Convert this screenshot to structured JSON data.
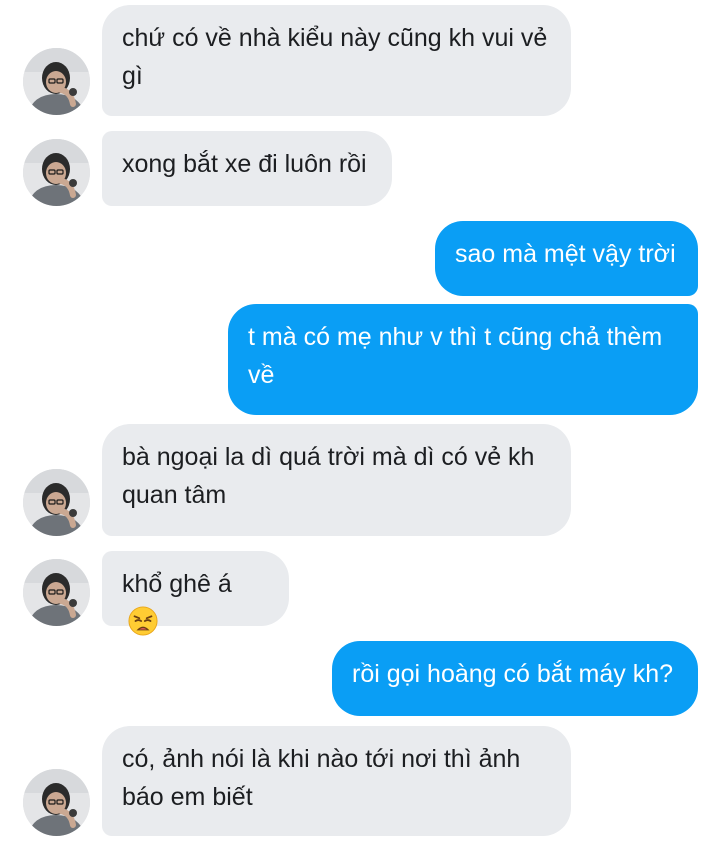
{
  "conversation": {
    "messages": [
      {
        "sender": "them",
        "text": "chứ có về nhà kiểu này cũng kh vui vẻ gì"
      },
      {
        "sender": "them",
        "text": "xong bắt xe đi luôn rồi"
      },
      {
        "sender": "me",
        "text": "sao mà mệt vậy trời"
      },
      {
        "sender": "me",
        "text": "t mà có mẹ như v thì t cũng chả thèm về"
      },
      {
        "sender": "them",
        "text": "bà ngoại la dì quá trời mà dì có vẻ kh quan tâm"
      },
      {
        "sender": "them",
        "text": "khổ ghê á",
        "emoji": "weary-face"
      },
      {
        "sender": "me",
        "text": "rồi gọi hoàng có bắt máy kh?"
      },
      {
        "sender": "them",
        "text": "có, ảnh nói là khi nào tới nơi thì ảnh báo em biết"
      }
    ]
  },
  "colors": {
    "incoming_bubble": "#e9ebee",
    "outgoing_bubble": "#0a9ef5",
    "incoming_text": "#1c1e21",
    "outgoing_text": "#ffffff"
  },
  "icons": {
    "avatar": "contact-avatar",
    "emoji": "weary-face-emoji"
  }
}
